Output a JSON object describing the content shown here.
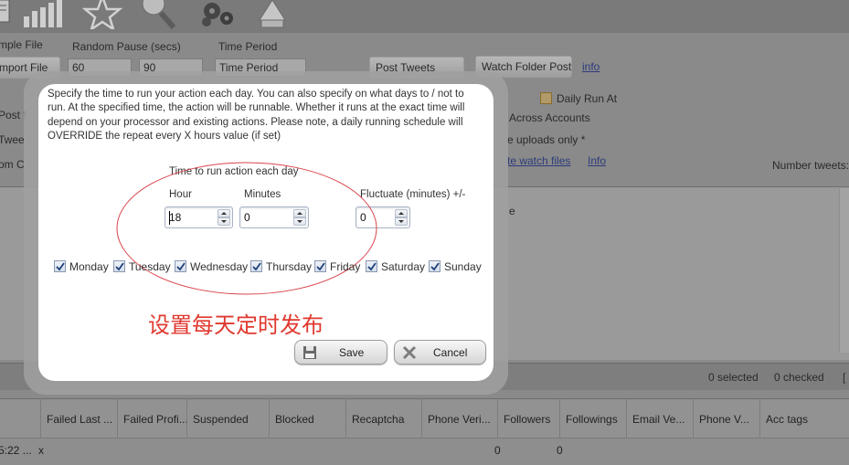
{
  "background": {
    "toolbar_icons": [
      "document-icon",
      "bar-chart-icon",
      "star-icon",
      "magnifier-icon",
      "gears-icon",
      "robot-icon"
    ],
    "labels": {
      "sample_file": "mple File",
      "random_pause": "Random Pause (secs)",
      "time_period": "Time Period",
      "post_f": "Post f",
      "twee": "Twee",
      "om_c": "om C",
      "daily_run_at": "Daily Run At",
      "across_accounts": "Across Accounts",
      "uploads_only": "e uploads only *",
      "number_tweets": "Number tweets:",
      "e_fragment": "e"
    },
    "import_file_button": "mport File",
    "pause_min": "60",
    "pause_max": "90",
    "time_period_select": "Time Period",
    "post_tweets_button": "Post Tweets",
    "watch_folder_button": "Watch Folder Post",
    "info_link_1": "info",
    "watch_files_link": "te watch files",
    "info_link_2": "Info",
    "status": {
      "selected": "0 selected",
      "checked": "0 checked",
      "bracket": "["
    },
    "grid": {
      "columns": [
        "Failed Last ...",
        "Failed Profi...",
        "Suspended",
        "Blocked",
        "Recaptcha",
        "Phone Veri...",
        "Followers",
        "Followings",
        "Email Ve...",
        "Phone V...",
        "Acc tags"
      ],
      "row": {
        "time": "5:22 ...",
        "x": "x",
        "followers": "0",
        "followings": "0"
      }
    }
  },
  "dialog": {
    "intro_lines": [
      "Specify the time to run your action each day. You can also specify on what days to / not to",
      "run. At the specified time, the action will be runnable. Whether it runs at the exact time will",
      "depend on your processor and existing actions. Please note, a daily running schedule will",
      "OVERRIDE the repeat every X hours value (if set)"
    ],
    "section_label": "Time to run action each day",
    "hour_label": "Hour",
    "minutes_label": "Minutes",
    "fluctuate_label": "Fluctuate (minutes) +/-",
    "hour_value": "18",
    "minutes_value": "0",
    "fluctuate_value": "0",
    "days": [
      {
        "label": "Monday",
        "checked": true
      },
      {
        "label": "Tuesday",
        "checked": true
      },
      {
        "label": "Wednesday",
        "checked": true
      },
      {
        "label": "Thursday",
        "checked": true
      },
      {
        "label": "Friday",
        "checked": true
      },
      {
        "label": "Saturday",
        "checked": true
      },
      {
        "label": "Sunday",
        "checked": true
      }
    ],
    "annotation": "设置每天定时发布",
    "annotation_color": "#e0392f",
    "save_label": "Save",
    "cancel_label": "Cancel"
  }
}
